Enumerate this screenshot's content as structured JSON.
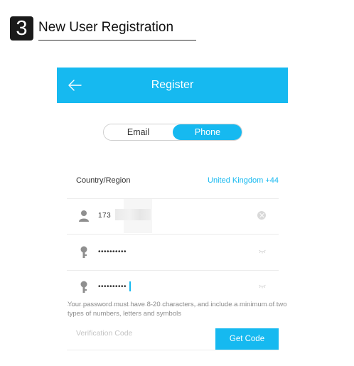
{
  "step": {
    "number": "3",
    "title": "New User Registration"
  },
  "appbar": {
    "title": "Register",
    "back_icon": "arrow-left-icon"
  },
  "tabs": [
    {
      "label": "Email",
      "selected": false
    },
    {
      "label": "Phone",
      "selected": true
    }
  ],
  "form": {
    "country_label": "Country/Region",
    "country_value": "United Kingdom +44",
    "phone_value": "173",
    "password_value": "••••••••••",
    "confirm_password_value": "••••••••••",
    "password_hint": "Your password must have 8-20 characters, and include a minimum of two types of numbers, letters and symbols",
    "verification_placeholder": "Verification Code",
    "get_code_label": "Get Code"
  },
  "colors": {
    "accent": "#16b9f0",
    "hint": "#8d8d8d"
  }
}
